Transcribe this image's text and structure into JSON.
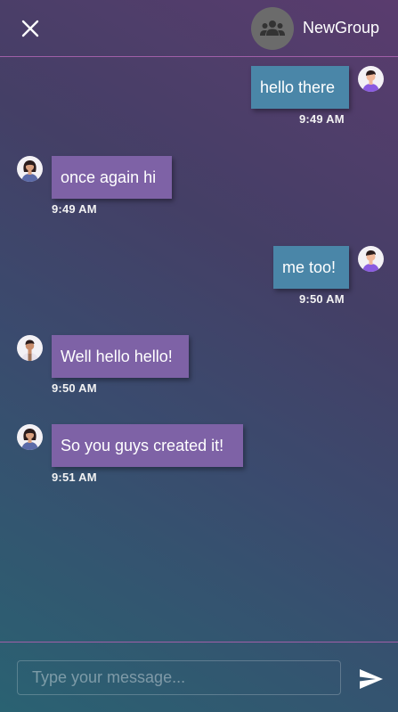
{
  "header": {
    "close_icon": "close-icon",
    "group_icon": "group-people-icon",
    "group_name": "NewGroup"
  },
  "messages": [
    {
      "direction": "out",
      "text": "hello there",
      "time": "9:49 AM",
      "avatar": "male-avatar-purple"
    },
    {
      "direction": "in",
      "text": "once again hi",
      "time": "9:49 AM",
      "avatar": "female-avatar"
    },
    {
      "direction": "out",
      "text": "me too!",
      "time": "9:50 AM",
      "avatar": "male-avatar-purple"
    },
    {
      "direction": "in",
      "text": "Well hello hello!",
      "time": "9:50 AM",
      "avatar": "male-avatar-brown"
    },
    {
      "direction": "in",
      "text": "So you guys created it!",
      "time": "9:51 AM",
      "avatar": "female-avatar"
    }
  ],
  "composer": {
    "placeholder": "Type your message...",
    "value": "",
    "send_icon": "send-icon"
  },
  "colors": {
    "outgoing_bubble": "#4a86a8",
    "incoming_bubble": "#7e62a6",
    "divider": "#a05fa8",
    "group_avatar_bg": "#6b6b6b"
  }
}
